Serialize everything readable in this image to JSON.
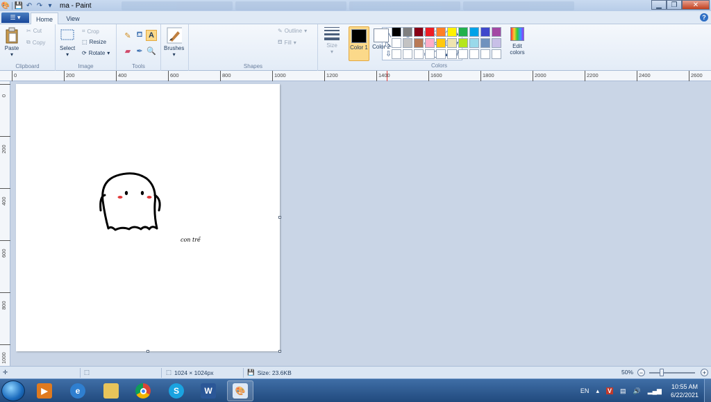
{
  "window": {
    "title": "ma - Paint"
  },
  "ribbon_tabs": {
    "file": "▾",
    "home": "Home",
    "view": "View"
  },
  "clipboard": {
    "paste": "Paste",
    "cut": "Cut",
    "copy": "Copy",
    "label": "Clipboard"
  },
  "image": {
    "select": "Select",
    "crop": "Crop",
    "resize": "Resize",
    "rotate": "Rotate",
    "label": "Image"
  },
  "tools": {
    "label": "Tools"
  },
  "brushes": {
    "label": "Brushes"
  },
  "shapes": {
    "outline": "Outline",
    "fill": "Fill",
    "label": "Shapes"
  },
  "size": {
    "label": "Size"
  },
  "colors": {
    "color1_label": "Color 1",
    "color2_label": "Color 2",
    "color1": "#000000",
    "color2": "#ffffff",
    "edit_colors": "Edit colors",
    "label": "Colors",
    "palette": [
      "#000000",
      "#7f7f7f",
      "#880015",
      "#ed1c24",
      "#ff7f27",
      "#fff200",
      "#22b14c",
      "#00a2e8",
      "#3f48cc",
      "#a349a4",
      "#ffffff",
      "#c3c3c3",
      "#b97a57",
      "#ffaec9",
      "#ffc90e",
      "#efe4b0",
      "#b5e61d",
      "#99d9ea",
      "#7092be",
      "#c8bfe7",
      "#ffffff",
      "#ffffff",
      "#ffffff",
      "#ffffff",
      "#ffffff",
      "#ffffff",
      "#ffffff",
      "#ffffff",
      "#ffffff",
      "#ffffff"
    ]
  },
  "ruler": {
    "top": [
      "0",
      "200",
      "400",
      "600",
      "800",
      "1000",
      "1200",
      "1400",
      "1600",
      "1800",
      "2000",
      "2200",
      "2400",
      "2600"
    ],
    "left": [
      "0",
      "200",
      "400",
      "600",
      "800",
      "1000"
    ]
  },
  "canvas": {
    "signature": "con trề"
  },
  "status": {
    "dimensions": "1024 × 1024px",
    "size": "Size: 23.6KB",
    "zoom": "50%"
  },
  "tray": {
    "lang": "EN",
    "time": "10:55 AM",
    "date": "6/22/2021"
  }
}
